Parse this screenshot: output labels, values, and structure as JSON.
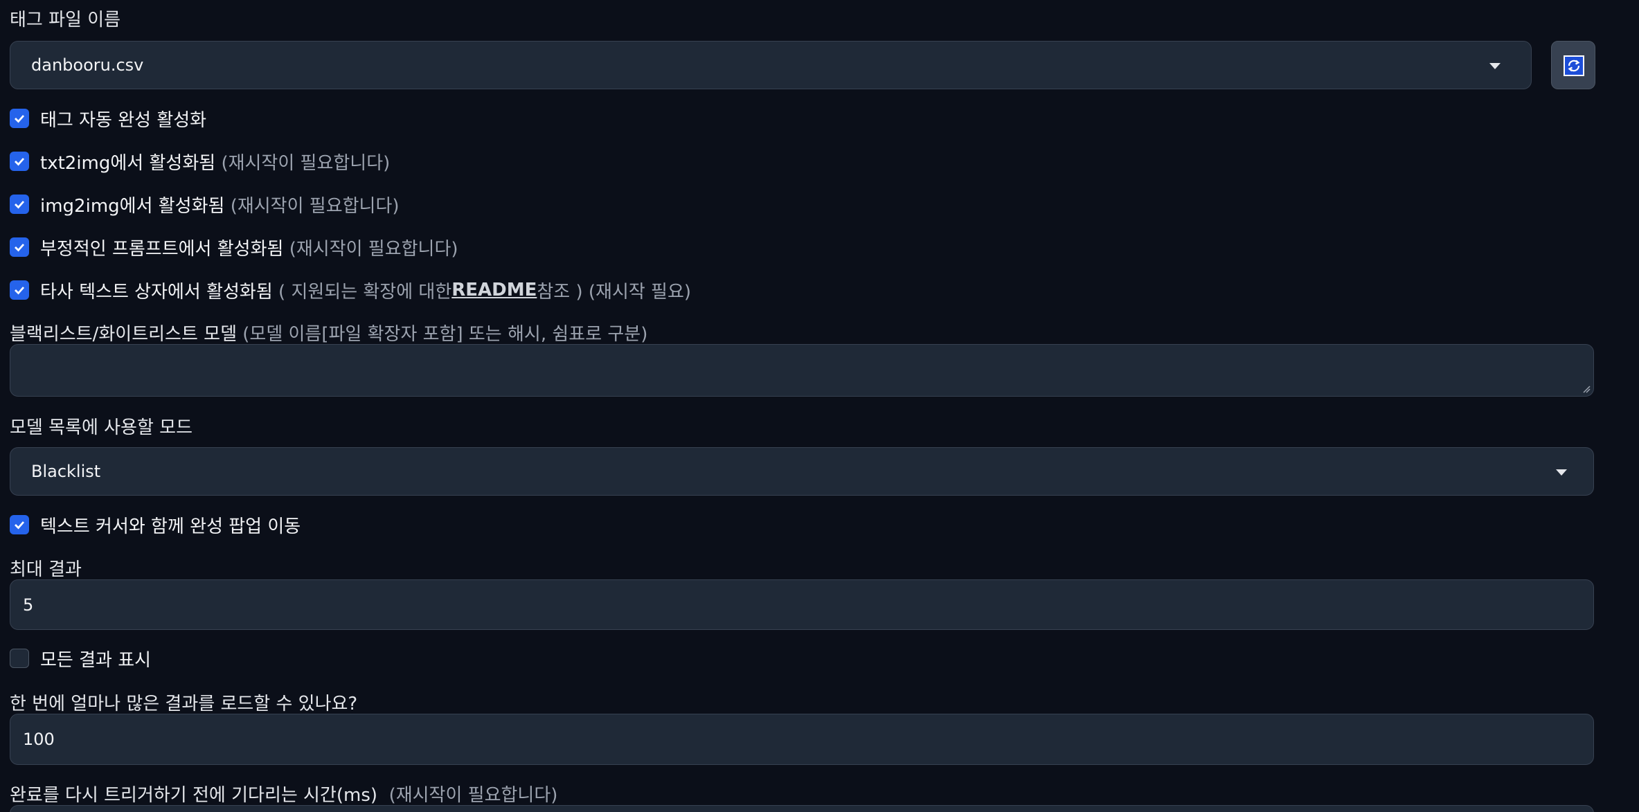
{
  "tag_file": {
    "label": "태그 파일 이름",
    "selected": "danbooru.csv",
    "refresh_icon": "refresh-icon"
  },
  "checks": {
    "enable": {
      "label": "태그 자동 완성 활성화",
      "checked": true
    },
    "txt2img": {
      "label": "txt2img에서 활성화됨",
      "note": "(재시작이 필요합니다)",
      "checked": true
    },
    "img2img": {
      "label": "img2img에서 활성화됨",
      "note": "(재시작이 필요합니다)",
      "checked": true
    },
    "negative": {
      "label": "부정적인 프롬프트에서 활성화됨",
      "note": "(재시작이 필요합니다)",
      "checked": true
    },
    "third_party": {
      "label": "타사 텍스트 상자에서 활성화됨",
      "note_pre": "( 지원되는 확장에 대한 ",
      "link": "README",
      "note_post": " 참조 ) (재시작 필요)",
      "checked": true
    }
  },
  "model_list": {
    "label": "블랙리스트/화이트리스트 모델",
    "note": "(모델 이름[파일 확장자 포함] 또는 해시, 쉼표로 구분)",
    "value": ""
  },
  "model_mode": {
    "label": "모델 목록에 사용할 모드",
    "selected": "Blacklist"
  },
  "move_popup": {
    "label": "텍스트 커서와 함께 완성 팝업 이동",
    "checked": true
  },
  "max_results": {
    "label": "최대 결과",
    "value": "5"
  },
  "show_all": {
    "label": "모든 결과 표시",
    "checked": false
  },
  "load_count": {
    "label": "한 번에 얼마나 많은 결과를 로드할 수 있나요?",
    "value": "100"
  },
  "delay": {
    "label": "완료를 다시 트리거하기 전에 기다리는 시간(ms)",
    "note": "(재시작이 필요합니다)"
  },
  "colors": {
    "background": "#0b0f19",
    "field": "#1f2937",
    "accent": "#2563eb"
  }
}
